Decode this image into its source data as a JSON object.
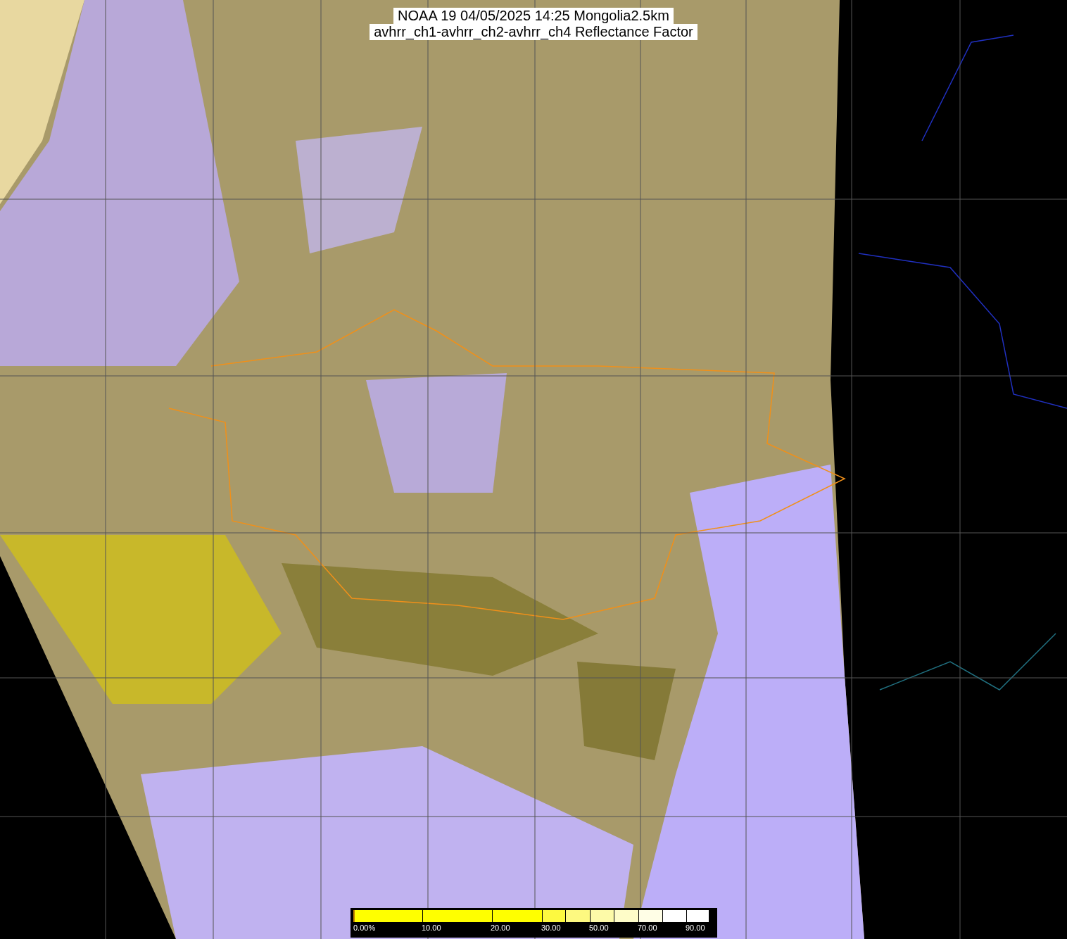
{
  "title": {
    "line_1": "NOAA 19 04/05/2025 14:25 Mongolia2.5km",
    "line_2": "avhrr_ch1-avhrr_ch2-avhrr_ch4 Reflectance Factor"
  },
  "legend": {
    "segments": [
      {
        "color": "#ffff00"
      },
      {
        "color": "#ffff00"
      },
      {
        "color": "#ffff00"
      },
      {
        "color": "#fdf940"
      },
      {
        "color": "#fdf980"
      },
      {
        "color": "#fdfaa8"
      },
      {
        "color": "#fefcc8"
      },
      {
        "color": "#fffee6"
      },
      {
        "color": "#ffffff"
      },
      {
        "color": "#ffffff"
      }
    ],
    "ticks": [
      "0.00%",
      "10.00",
      "20.00",
      "30.00",
      "50.00",
      "70.00",
      "90.00"
    ]
  }
}
